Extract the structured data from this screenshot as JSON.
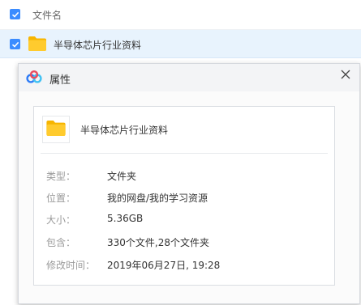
{
  "list": {
    "header_label": "文件名",
    "header_checked": true,
    "row": {
      "name": "半导体芯片行业资料",
      "checked": true,
      "icon": "folder-icon"
    }
  },
  "dialog": {
    "title": "属性",
    "logo_icon": "baidu-netdisk-logo-icon",
    "close_label": "×",
    "folder_name": "半导体芯片行业资料",
    "properties": [
      {
        "label": "类型：",
        "value": "文件夹"
      },
      {
        "label": "位置：",
        "value": "我的网盘/我的学习资源"
      },
      {
        "label": "大小：",
        "value": "5.36GB"
      },
      {
        "label": "包含：",
        "value": "330个文件,28个文件夹"
      },
      {
        "label": "修改时间：",
        "value": "2019年06月27日, 19:28"
      }
    ]
  },
  "colors": {
    "accent": "#3b8cff",
    "folder_yellow": "#ffcb2e",
    "selected_row": "#e8f3fd"
  }
}
